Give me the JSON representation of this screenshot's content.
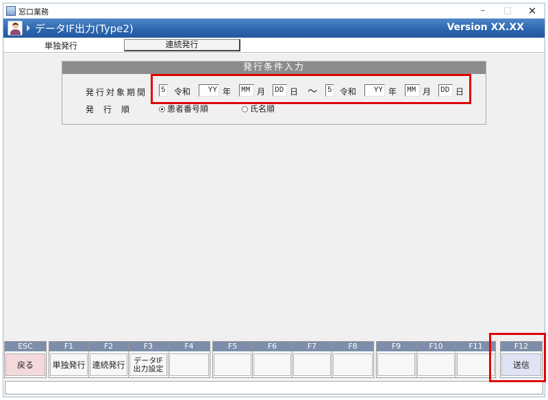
{
  "window": {
    "app_title": "窓口業務",
    "minimize": "–",
    "maximize": "□",
    "close": "✕"
  },
  "header": {
    "title": "データIF出力(Type2)",
    "version": "Version XX.XX"
  },
  "mode_tabs": {
    "single": "単独発行",
    "continuous": "連続発行"
  },
  "conditions": {
    "heading": "発行条件入力",
    "period_label": "発行対象期間",
    "from": {
      "era_code": "5",
      "era_name": "令和",
      "year": "YY",
      "year_unit": "年",
      "month": "MM",
      "month_unit": "月",
      "day": "DD",
      "day_unit": "日"
    },
    "range_sep": "～",
    "to": {
      "era_code": "5",
      "era_name": "令和",
      "year": "YY",
      "year_unit": "年",
      "month": "MM",
      "month_unit": "月",
      "day": "DD",
      "day_unit": "日"
    },
    "order_label": "発行順",
    "order_options": [
      {
        "label": "患者番号順",
        "selected": true
      },
      {
        "label": "氏名順",
        "selected": false
      }
    ]
  },
  "function_keys": [
    {
      "key": "ESC",
      "label": "戻る"
    },
    {
      "key": "F1",
      "label": "単独発行"
    },
    {
      "key": "F2",
      "label": "連続発行"
    },
    {
      "key": "F3",
      "label_line1": "データIF",
      "label_line2": "出力設定"
    },
    {
      "key": "F4",
      "label": ""
    },
    {
      "key": "F5",
      "label": ""
    },
    {
      "key": "F6",
      "label": ""
    },
    {
      "key": "F7",
      "label": ""
    },
    {
      "key": "F8",
      "label": ""
    },
    {
      "key": "F9",
      "label": ""
    },
    {
      "key": "F10",
      "label": ""
    },
    {
      "key": "F11",
      "label": ""
    },
    {
      "key": "F12",
      "label": "送信"
    }
  ],
  "colors": {
    "header_blue": "#2b64ad",
    "fkey_caption": "#7c8ea9",
    "highlight_red": "#e00000",
    "esc_button": "#f3d9dc",
    "send_button": "#dfe3f3"
  }
}
